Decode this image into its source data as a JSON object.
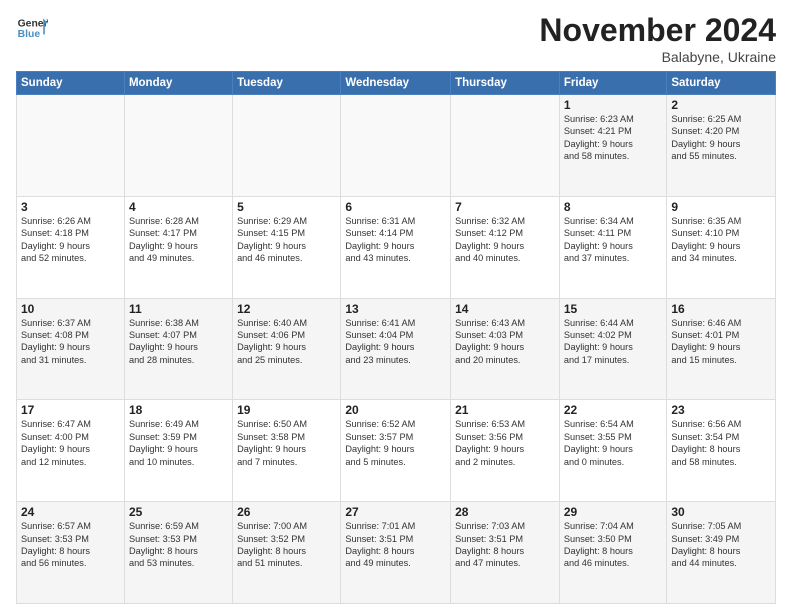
{
  "logo": {
    "general": "General",
    "blue": "Blue"
  },
  "title": "November 2024",
  "location": "Balabyne, Ukraine",
  "days_of_week": [
    "Sunday",
    "Monday",
    "Tuesday",
    "Wednesday",
    "Thursday",
    "Friday",
    "Saturday"
  ],
  "weeks": [
    [
      {
        "day": "",
        "content": ""
      },
      {
        "day": "",
        "content": ""
      },
      {
        "day": "",
        "content": ""
      },
      {
        "day": "",
        "content": ""
      },
      {
        "day": "",
        "content": ""
      },
      {
        "day": "1",
        "content": "Sunrise: 6:23 AM\nSunset: 4:21 PM\nDaylight: 9 hours\nand 58 minutes."
      },
      {
        "day": "2",
        "content": "Sunrise: 6:25 AM\nSunset: 4:20 PM\nDaylight: 9 hours\nand 55 minutes."
      }
    ],
    [
      {
        "day": "3",
        "content": "Sunrise: 6:26 AM\nSunset: 4:18 PM\nDaylight: 9 hours\nand 52 minutes."
      },
      {
        "day": "4",
        "content": "Sunrise: 6:28 AM\nSunset: 4:17 PM\nDaylight: 9 hours\nand 49 minutes."
      },
      {
        "day": "5",
        "content": "Sunrise: 6:29 AM\nSunset: 4:15 PM\nDaylight: 9 hours\nand 46 minutes."
      },
      {
        "day": "6",
        "content": "Sunrise: 6:31 AM\nSunset: 4:14 PM\nDaylight: 9 hours\nand 43 minutes."
      },
      {
        "day": "7",
        "content": "Sunrise: 6:32 AM\nSunset: 4:12 PM\nDaylight: 9 hours\nand 40 minutes."
      },
      {
        "day": "8",
        "content": "Sunrise: 6:34 AM\nSunset: 4:11 PM\nDaylight: 9 hours\nand 37 minutes."
      },
      {
        "day": "9",
        "content": "Sunrise: 6:35 AM\nSunset: 4:10 PM\nDaylight: 9 hours\nand 34 minutes."
      }
    ],
    [
      {
        "day": "10",
        "content": "Sunrise: 6:37 AM\nSunset: 4:08 PM\nDaylight: 9 hours\nand 31 minutes."
      },
      {
        "day": "11",
        "content": "Sunrise: 6:38 AM\nSunset: 4:07 PM\nDaylight: 9 hours\nand 28 minutes."
      },
      {
        "day": "12",
        "content": "Sunrise: 6:40 AM\nSunset: 4:06 PM\nDaylight: 9 hours\nand 25 minutes."
      },
      {
        "day": "13",
        "content": "Sunrise: 6:41 AM\nSunset: 4:04 PM\nDaylight: 9 hours\nand 23 minutes."
      },
      {
        "day": "14",
        "content": "Sunrise: 6:43 AM\nSunset: 4:03 PM\nDaylight: 9 hours\nand 20 minutes."
      },
      {
        "day": "15",
        "content": "Sunrise: 6:44 AM\nSunset: 4:02 PM\nDaylight: 9 hours\nand 17 minutes."
      },
      {
        "day": "16",
        "content": "Sunrise: 6:46 AM\nSunset: 4:01 PM\nDaylight: 9 hours\nand 15 minutes."
      }
    ],
    [
      {
        "day": "17",
        "content": "Sunrise: 6:47 AM\nSunset: 4:00 PM\nDaylight: 9 hours\nand 12 minutes."
      },
      {
        "day": "18",
        "content": "Sunrise: 6:49 AM\nSunset: 3:59 PM\nDaylight: 9 hours\nand 10 minutes."
      },
      {
        "day": "19",
        "content": "Sunrise: 6:50 AM\nSunset: 3:58 PM\nDaylight: 9 hours\nand 7 minutes."
      },
      {
        "day": "20",
        "content": "Sunrise: 6:52 AM\nSunset: 3:57 PM\nDaylight: 9 hours\nand 5 minutes."
      },
      {
        "day": "21",
        "content": "Sunrise: 6:53 AM\nSunset: 3:56 PM\nDaylight: 9 hours\nand 2 minutes."
      },
      {
        "day": "22",
        "content": "Sunrise: 6:54 AM\nSunset: 3:55 PM\nDaylight: 9 hours\nand 0 minutes."
      },
      {
        "day": "23",
        "content": "Sunrise: 6:56 AM\nSunset: 3:54 PM\nDaylight: 8 hours\nand 58 minutes."
      }
    ],
    [
      {
        "day": "24",
        "content": "Sunrise: 6:57 AM\nSunset: 3:53 PM\nDaylight: 8 hours\nand 56 minutes."
      },
      {
        "day": "25",
        "content": "Sunrise: 6:59 AM\nSunset: 3:53 PM\nDaylight: 8 hours\nand 53 minutes."
      },
      {
        "day": "26",
        "content": "Sunrise: 7:00 AM\nSunset: 3:52 PM\nDaylight: 8 hours\nand 51 minutes."
      },
      {
        "day": "27",
        "content": "Sunrise: 7:01 AM\nSunset: 3:51 PM\nDaylight: 8 hours\nand 49 minutes."
      },
      {
        "day": "28",
        "content": "Sunrise: 7:03 AM\nSunset: 3:51 PM\nDaylight: 8 hours\nand 47 minutes."
      },
      {
        "day": "29",
        "content": "Sunrise: 7:04 AM\nSunset: 3:50 PM\nDaylight: 8 hours\nand 46 minutes."
      },
      {
        "day": "30",
        "content": "Sunrise: 7:05 AM\nSunset: 3:49 PM\nDaylight: 8 hours\nand 44 minutes."
      }
    ]
  ]
}
